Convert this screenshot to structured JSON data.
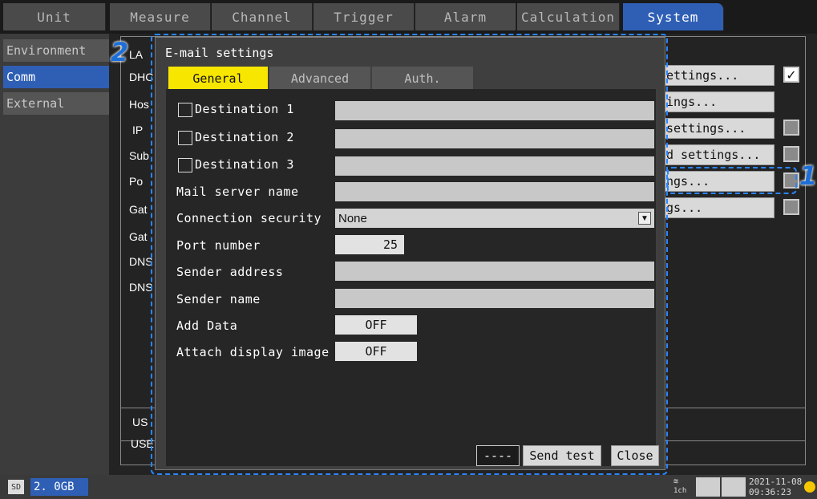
{
  "top_tabs": [
    "Unit",
    "Measure",
    "Channel",
    "Trigger",
    "Alarm",
    "Calculation",
    "System"
  ],
  "sidebar": {
    "items": [
      "Environment",
      "Comm",
      "External"
    ]
  },
  "background": {
    "labels": [
      "LA",
      "DHC",
      "Hos",
      "IP",
      "Sub",
      "Po",
      "Gat",
      "Gat",
      "DNS",
      "DNS"
    ],
    "buttons": [
      "ettings...",
      "ings...",
      "settings...",
      "d settings...",
      "ngs...",
      "gs..."
    ],
    "usb_labels": [
      "US",
      "USE"
    ]
  },
  "dialog": {
    "title": "E-mail settings",
    "tabs": [
      "General",
      "Advanced",
      "Auth."
    ],
    "destinations": [
      "Destination 1",
      "Destination 2",
      "Destination 3"
    ],
    "mail_server_label": "Mail server name",
    "connection_security_label": "Connection security",
    "connection_security_value": "None",
    "port_label": "Port number",
    "port_value": "25",
    "sender_address_label": "Sender address",
    "sender_name_label": "Sender name",
    "add_data_label": "Add Data",
    "add_data_value": "OFF",
    "attach_image_label": "Attach display image",
    "attach_image_value": "OFF",
    "status_box": "----",
    "send_test_label": "Send test",
    "close_label": "Close"
  },
  "status_bar": {
    "storage": "2. 0GB",
    "channel": "1ch",
    "date": "2021-11-08",
    "time": "09:36:23"
  },
  "callouts": [
    "2",
    "1"
  ],
  "colors": {
    "active_tab": "#2f5fb5",
    "dialog_tab_active": "#f7e600",
    "callout": "#1d6fd8"
  }
}
